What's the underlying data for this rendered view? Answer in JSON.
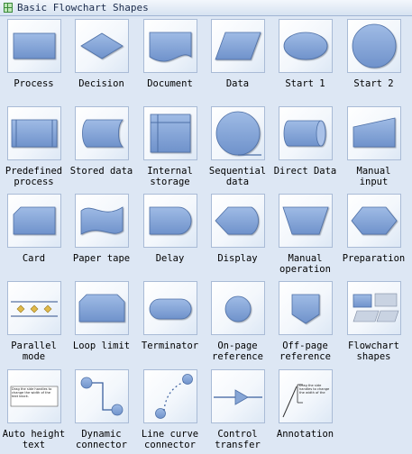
{
  "panel": {
    "title": "Basic Flowchart Shapes",
    "icon": "shapes-library-icon"
  },
  "shapes": [
    {
      "label": "Process",
      "icon": "process-shape-icon"
    },
    {
      "label": "Decision",
      "icon": "decision-shape-icon"
    },
    {
      "label": "Document",
      "icon": "document-shape-icon"
    },
    {
      "label": "Data",
      "icon": "data-shape-icon"
    },
    {
      "label": "Start 1",
      "icon": "start1-shape-icon"
    },
    {
      "label": "Start 2",
      "icon": "start2-shape-icon"
    },
    {
      "label": "Predefined\nprocess",
      "icon": "predefined-process-shape-icon"
    },
    {
      "label": "Stored data",
      "icon": "stored-data-shape-icon"
    },
    {
      "label": "Internal\nstorage",
      "icon": "internal-storage-shape-icon"
    },
    {
      "label": "Sequential\ndata",
      "icon": "sequential-data-shape-icon"
    },
    {
      "label": "Direct Data",
      "icon": "direct-data-shape-icon"
    },
    {
      "label": "Manual\ninput",
      "icon": "manual-input-shape-icon"
    },
    {
      "label": "Card",
      "icon": "card-shape-icon"
    },
    {
      "label": "Paper tape",
      "icon": "paper-tape-shape-icon"
    },
    {
      "label": "Delay",
      "icon": "delay-shape-icon"
    },
    {
      "label": "Display",
      "icon": "display-shape-icon"
    },
    {
      "label": "Manual\noperation",
      "icon": "manual-operation-shape-icon"
    },
    {
      "label": "Preparation",
      "icon": "preparation-shape-icon"
    },
    {
      "label": "Parallel\nmode",
      "icon": "parallel-mode-shape-icon"
    },
    {
      "label": "Loop limit",
      "icon": "loop-limit-shape-icon"
    },
    {
      "label": "Terminator",
      "icon": "terminator-shape-icon"
    },
    {
      "label": "On-page\nreference",
      "icon": "on-page-reference-shape-icon"
    },
    {
      "label": "Off-page\nreference",
      "icon": "off-page-reference-shape-icon"
    },
    {
      "label": "Flowchart\nshapes",
      "icon": "flowchart-shapes-icon"
    },
    {
      "label": "Auto height\ntext",
      "icon": "auto-height-text-icon",
      "thumb_text": "Drag the side handles to change the width of the text block."
    },
    {
      "label": "Dynamic\nconnector",
      "icon": "dynamic-connector-icon"
    },
    {
      "label": "Line curve\nconnector",
      "icon": "line-curve-connector-icon"
    },
    {
      "label": "Control\ntransfer",
      "icon": "control-transfer-icon"
    },
    {
      "label": "Annotation",
      "icon": "annotation-icon",
      "thumb_text": "Drag the side handles to change the width of the"
    }
  ]
}
